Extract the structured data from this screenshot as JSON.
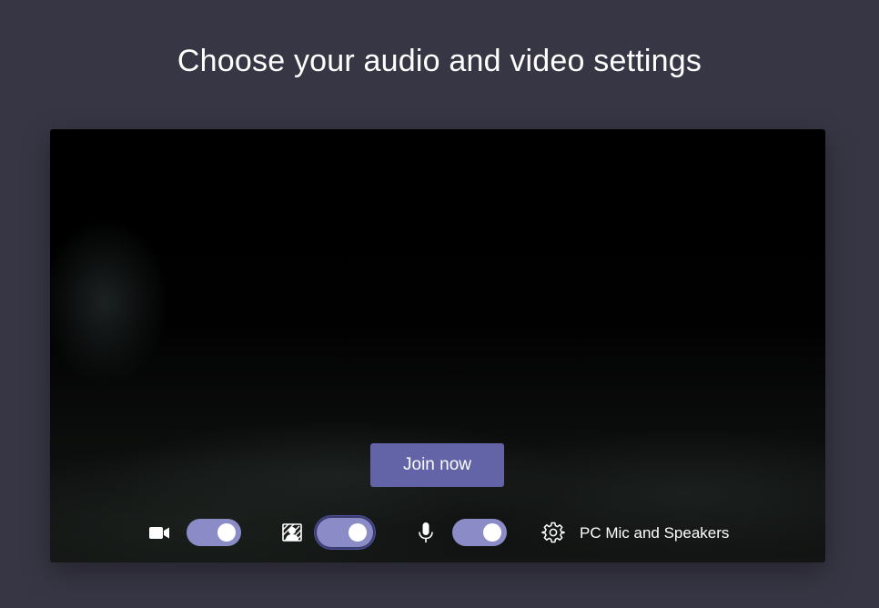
{
  "header": {
    "title": "Choose your audio and video settings"
  },
  "preview": {
    "join_label": "Join now"
  },
  "controls": {
    "camera_toggle": {
      "on": true
    },
    "background_blur_toggle": {
      "on": true
    },
    "mic_toggle": {
      "on": true
    },
    "device_label": "PC Mic and Speakers"
  },
  "icons": {
    "camera": "video-camera-icon",
    "background": "background-effects-icon",
    "mic": "microphone-icon",
    "settings": "gear-icon"
  },
  "colors": {
    "background": "#373644",
    "accent": "#6264a7",
    "toggle_on": "#8b8cc7"
  }
}
